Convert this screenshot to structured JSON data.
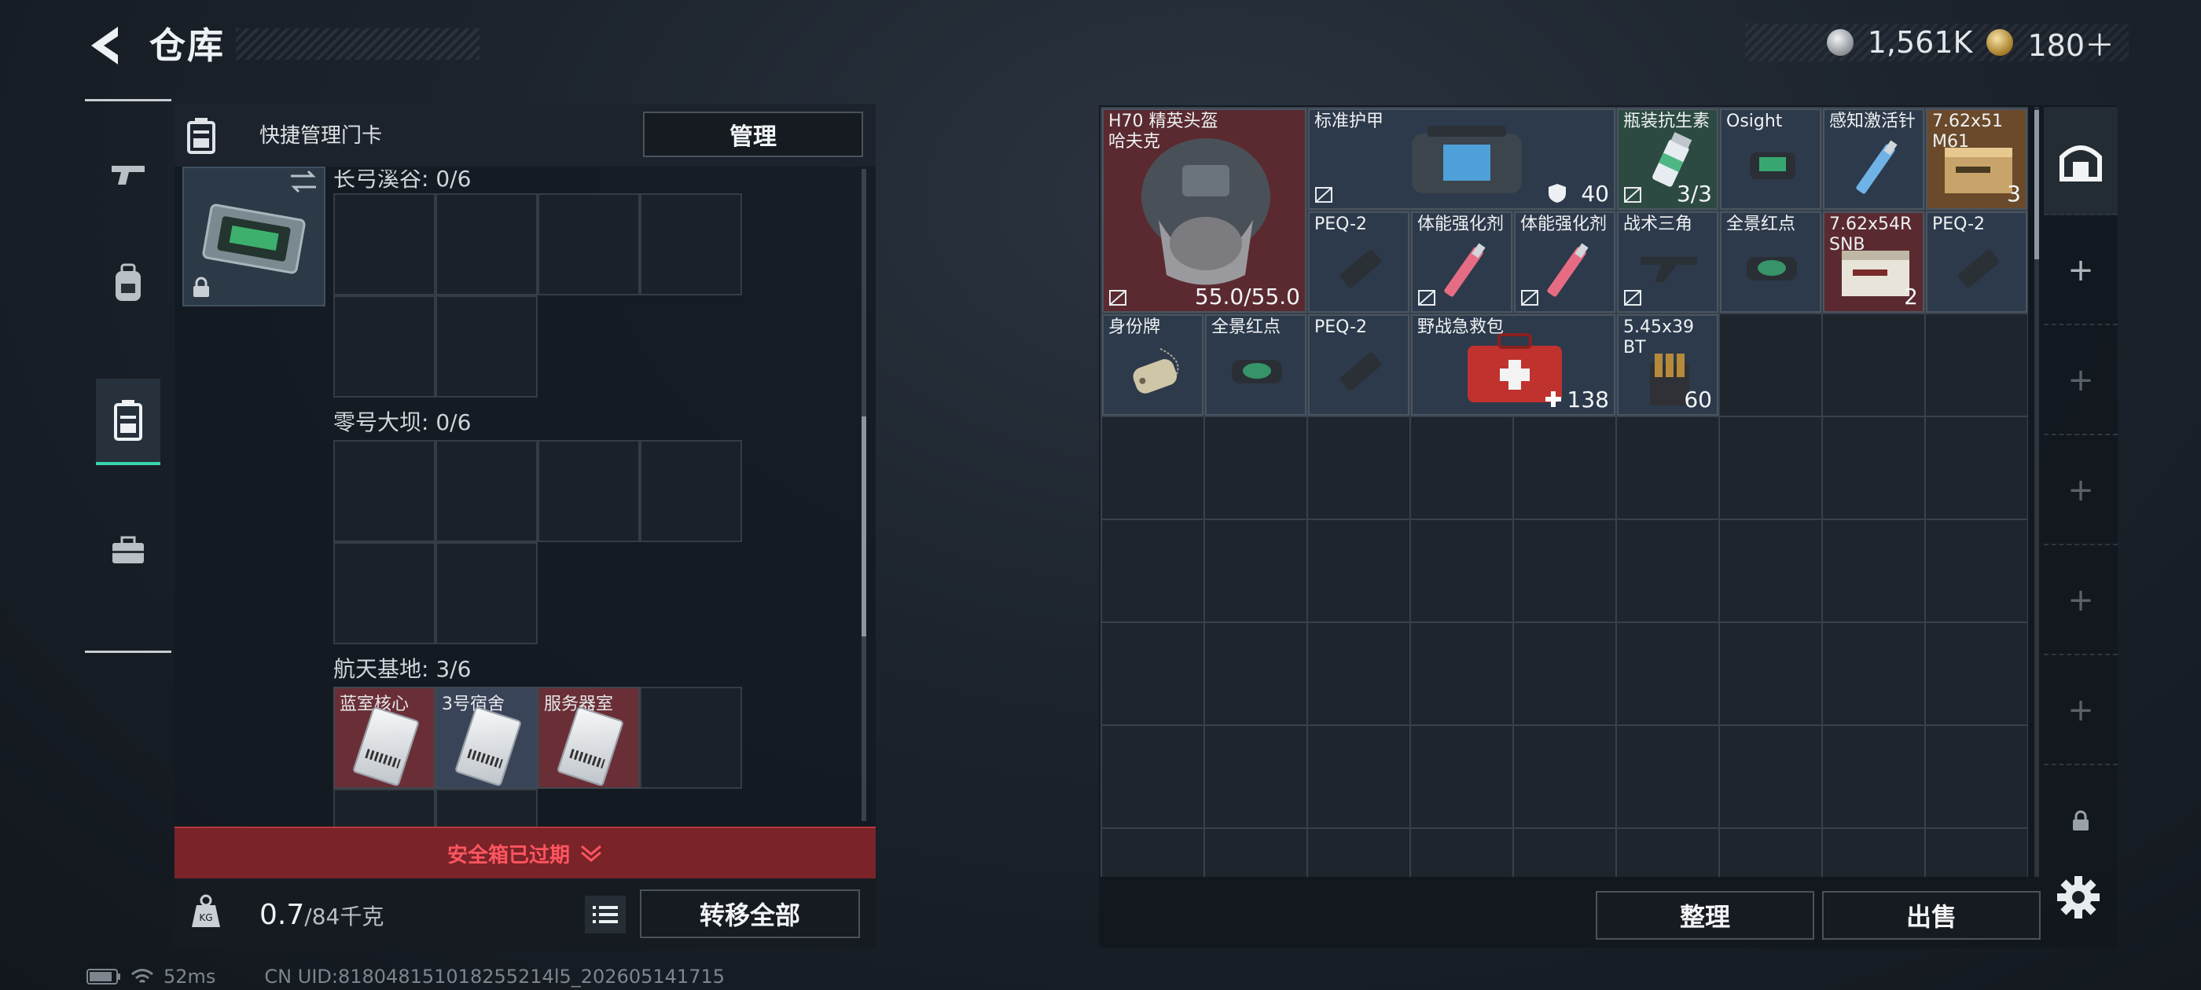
{
  "header": {
    "title": "仓库"
  },
  "currency": [
    {
      "icon": "silver-coin-icon",
      "value": "1,561K"
    },
    {
      "icon": "gold-coin-icon",
      "value": "180＋"
    }
  ],
  "left_nav": {
    "tabs": [
      {
        "icon": "weapon-icon",
        "active": false
      },
      {
        "icon": "backpack-icon",
        "active": false
      },
      {
        "icon": "keycard-case-icon",
        "active": true
      },
      {
        "icon": "toolbox-icon",
        "active": false
      }
    ]
  },
  "keycard_panel": {
    "title": "快捷管理门卡",
    "manage_label": "管理",
    "sections": [
      {
        "label": "长弓溪谷: 0/6",
        "cards": []
      },
      {
        "label": "零号大坝: 0/6",
        "cards": []
      },
      {
        "label": "航天基地: 3/6",
        "cards": [
          "蓝室核心",
          "3号宿舍",
          "服务器室"
        ]
      }
    ],
    "expired_label": "安全箱已过期",
    "weight_value": "0.7",
    "weight_max": "/84千克",
    "transfer_all_label": "转移全部"
  },
  "status_bar": {
    "ping": "52ms",
    "uid": "CN UID:818048151018255214l5_202605141715"
  },
  "stash": {
    "items": [
      {
        "name": "H70 精英头盔\n哈夫克",
        "count": "55.0/55.0",
        "rarity": "red"
      },
      {
        "name": "标准护甲",
        "count": "40",
        "rarity": "blue"
      },
      {
        "name": "瓶装抗生素",
        "count": "3/3",
        "rarity": "green"
      },
      {
        "name": "Osight",
        "count": "",
        "rarity": "blue"
      },
      {
        "name": "感知激活针",
        "count": "",
        "rarity": "blue"
      },
      {
        "name": "7.62x51\nM61",
        "count": "3",
        "rarity": "red"
      },
      {
        "name": "PEQ-2",
        "count": "",
        "rarity": "blue"
      },
      {
        "name": "体能强化剂",
        "count": "",
        "rarity": "blue"
      },
      {
        "name": "体能强化剂",
        "count": "",
        "rarity": "blue"
      },
      {
        "name": "战术三角",
        "count": "",
        "rarity": "blue"
      },
      {
        "name": "全景红点",
        "count": "",
        "rarity": "blue"
      },
      {
        "name": "7.62x54R\nSNB",
        "count": "2",
        "rarity": "red"
      },
      {
        "name": "PEQ-2",
        "count": "",
        "rarity": "blue"
      },
      {
        "name": "身份牌",
        "count": "",
        "rarity": "blue"
      },
      {
        "name": "全景红点",
        "count": "",
        "rarity": "blue"
      },
      {
        "name": "PEQ-2",
        "count": "",
        "rarity": "blue"
      },
      {
        "name": "野战急救包",
        "count": "138",
        "rarity": "blue"
      },
      {
        "name": "5.45x39\nBT",
        "count": "60",
        "rarity": "blue"
      }
    ],
    "sort_label": "整理",
    "sell_label": "出售"
  }
}
